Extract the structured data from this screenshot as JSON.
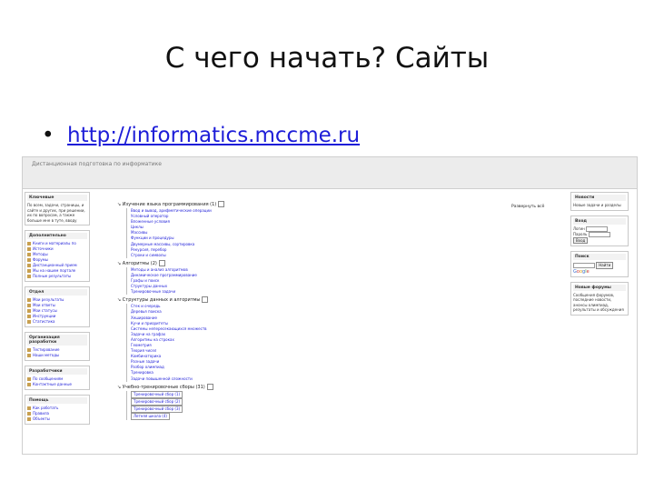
{
  "slide": {
    "title": "С чего начать? Сайты",
    "bullet": "•",
    "url": "http://informatics.mccme.ru"
  },
  "site": {
    "header_text": "Дистанционная подготовка по информатике",
    "mark_label": "Развернуть всё"
  },
  "left": {
    "box1": {
      "title": "Ключевые",
      "text": "По всем, задачи, страницы, и сайте и других, при решении, их по вопросам, а также больше мне в туте, вводу"
    },
    "box2": {
      "title": "Дополнительно",
      "links": [
        "Книги и материалы по",
        "Источники",
        "Методы",
        "Форумы",
        "Дистанционный прием",
        "Мы на нашем портале",
        "Полные результаты"
      ]
    },
    "box3": {
      "title": "Отдел",
      "links": [
        "Мои результаты",
        "Мои ответы",
        "Мои статусы",
        "Инструкции",
        "Статистика"
      ]
    },
    "box4": {
      "title": "Организация разработки",
      "links": [
        "Тестирование",
        "Наши методы"
      ]
    },
    "box5": {
      "title": "Разработчики",
      "links": [
        "По сообщениям",
        "Контактные данные"
      ]
    },
    "box6": {
      "title": "Помощь",
      "links": [
        "Как работать",
        "Правила",
        "Объекты"
      ]
    }
  },
  "sections": [
    {
      "heading": "Изучение языка программирования (1)",
      "items": [
        "Ввод и вывод, арифметические операции",
        "Условный оператор",
        "Вложенные условия",
        "Циклы",
        "Массивы",
        "Функции и процедуры",
        "Двумерные массивы, сортировка",
        "Рекурсия, перебор",
        "Строки и символы"
      ]
    },
    {
      "heading": "Алгоритмы (2)",
      "items": [
        "Методы и анализ алгоритмов",
        "Динамическое программирование",
        "Графы и поиск",
        "Структуры данных",
        "Тренировочные задачи"
      ]
    },
    {
      "heading": "Структуры данных и алгоритмы",
      "items": [
        "Стек и очередь",
        "Деревья поиска",
        "Хеширование",
        "Кучи и приоритеты",
        "Системы непересекающихся множеств",
        "Задачи на графах",
        "Алгоритмы на строках",
        "Геометрия",
        "Теория чисел",
        "Комбинаторика",
        "Разные задачи",
        "Разбор олимпиад",
        "Тренировка",
        "Задачи повышенной сложности"
      ]
    },
    {
      "heading": "Учебно-тренировочные сборы (31)",
      "items": [
        "Тренировочный сбор (1)",
        "Тренировочный сбор (2)",
        "Тренировочный сбор (3)",
        "Летняя школа (4)"
      ]
    }
  ],
  "right": {
    "box1": {
      "title": "Новости",
      "text": "Новые задачи и разделы"
    },
    "box2": {
      "title": "Вход",
      "login_label": "Логин",
      "password_label": "Пароль",
      "button": "Вход"
    },
    "box3": {
      "title": "Поиск",
      "button": "Найти"
    },
    "box4": {
      "title": "Новые форумы",
      "text": "Сообщения форумов, последние новости, анонсы олимпиад, результаты и обсуждения"
    }
  }
}
